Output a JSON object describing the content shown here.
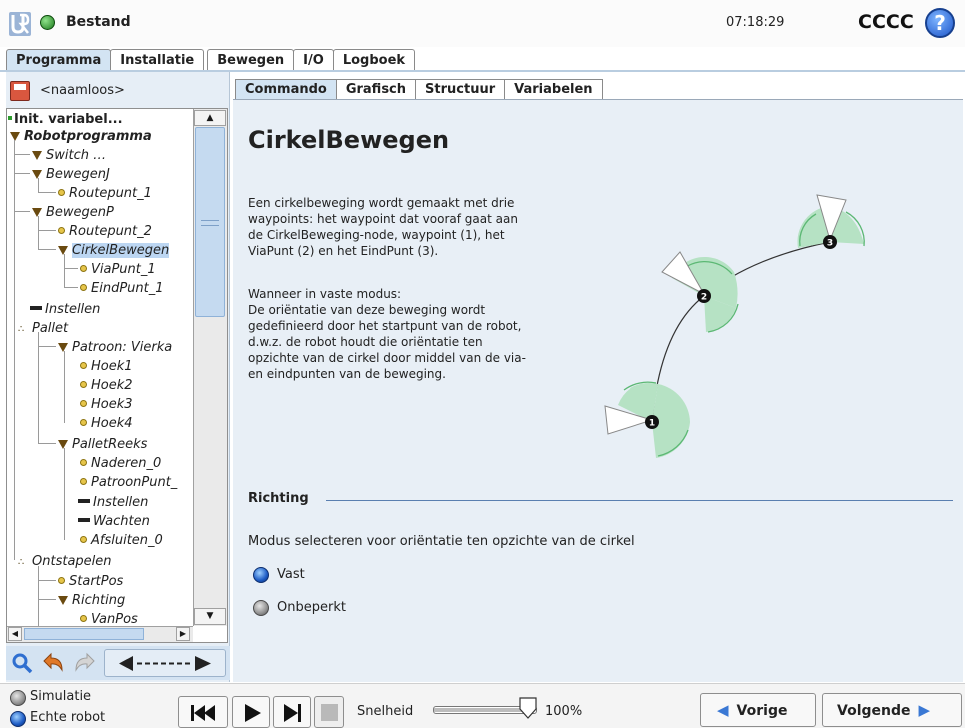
{
  "header": {
    "app_title": "Bestand",
    "clock": "07:18:29",
    "robot_name": "CCCC",
    "help_glyph": "?"
  },
  "top_tabs": [
    "Programma",
    "Installatie",
    "Bewegen",
    "I/O",
    "Logboek"
  ],
  "program": {
    "name": "<naamloos>"
  },
  "tree": [
    {
      "label": "Init. variabel...",
      "icon": "green-node-icon",
      "style": "bold"
    },
    {
      "label": "Robotprogramma",
      "icon": "triangle-icon",
      "style": "bold-italic"
    },
    {
      "label": "Switch …",
      "icon": "triangle-icon",
      "style": "italic"
    },
    {
      "label": "BewegenJ",
      "icon": "triangle-icon",
      "style": "italic"
    },
    {
      "label": "Routepunt_1",
      "icon": "waypoint-icon",
      "style": "italic"
    },
    {
      "label": "BewegenP",
      "icon": "triangle-icon",
      "style": "italic"
    },
    {
      "label": "Routepunt_2",
      "icon": "waypoint-icon",
      "style": "italic"
    },
    {
      "label": "CirkelBewegen",
      "icon": "triangle-icon",
      "style": "italic",
      "selected": true
    },
    {
      "label": "ViaPunt_1",
      "icon": "waypoint-icon",
      "style": "italic"
    },
    {
      "label": "EindPunt_1",
      "icon": "waypoint-icon",
      "style": "italic"
    },
    {
      "label": "Instellen",
      "icon": "set-icon",
      "style": "italic"
    },
    {
      "label": "Pallet",
      "icon": "pallet-icon",
      "style": "italic"
    },
    {
      "label": "Patroon: Vierka",
      "icon": "triangle-icon",
      "style": "italic"
    },
    {
      "label": "Hoek1",
      "icon": "waypoint-icon",
      "style": "italic"
    },
    {
      "label": "Hoek2",
      "icon": "waypoint-icon",
      "style": "italic"
    },
    {
      "label": "Hoek3",
      "icon": "waypoint-icon",
      "style": "italic"
    },
    {
      "label": "Hoek4",
      "icon": "waypoint-icon",
      "style": "italic"
    },
    {
      "label": "PalletReeks",
      "icon": "triangle-icon",
      "style": "italic"
    },
    {
      "label": "Naderen_0",
      "icon": "waypoint-icon",
      "style": "italic"
    },
    {
      "label": "PatroonPunt_",
      "icon": "waypoint-icon",
      "style": "italic"
    },
    {
      "label": "Instellen",
      "icon": "set-icon",
      "style": "italic"
    },
    {
      "label": "Wachten",
      "icon": "set-icon",
      "style": "italic"
    },
    {
      "label": "Afsluiten_0",
      "icon": "waypoint-icon",
      "style": "italic"
    },
    {
      "label": "Ontstapelen",
      "icon": "pallet-icon",
      "style": "italic"
    },
    {
      "label": "StartPos",
      "icon": "waypoint-icon",
      "style": "italic"
    },
    {
      "label": "Richting",
      "icon": "triangle-icon",
      "style": "italic"
    },
    {
      "label": "VanPos",
      "icon": "waypoint-icon",
      "style": "italic"
    }
  ],
  "sub_tabs": [
    "Commando",
    "Grafisch",
    "Structuur",
    "Variabelen"
  ],
  "command": {
    "title": "CirkelBewegen",
    "description_lines": [
      "Een cirkelbeweging wordt gemaakt met drie",
      "waypoints: het waypoint dat vooraf gaat aan",
      "de CirkelBeweging-node, waypoint (1), het",
      "ViaPunt (2) en het EindPunt (3)."
    ],
    "mode_lines": [
      "Wanneer in vaste modus:",
      "De oriëntatie van deze beweging wordt",
      "gedefinieerd door het startpunt van de robot,",
      "d.w.z. de robot houdt die oriëntatie ten",
      "opzichte van de cirkel door middel van de via-",
      "en eindpunten van de beweging."
    ],
    "diagram_points": [
      "1",
      "2",
      "3"
    ],
    "section_title": "Richting",
    "mode_prompt": "Modus selecteren voor oriëntatie ten opzichte van de cirkel",
    "options": [
      {
        "label": "Vast",
        "selected": true
      },
      {
        "label": "Onbeperkt",
        "selected": false
      }
    ]
  },
  "footer": {
    "simulation_label": "Simulatie",
    "real_robot_label": "Echte robot",
    "speed_label": "Snelheid",
    "speed_value": "100%",
    "speed_fraction": 1.0,
    "prev_label": "Vorige",
    "next_label": "Volgende"
  },
  "colors": {
    "accent_blue": "#3a78d4",
    "tab_active": "#d3e4f3",
    "panel_bg": "#e8eff6",
    "sector_green": "#b6e2c4"
  }
}
